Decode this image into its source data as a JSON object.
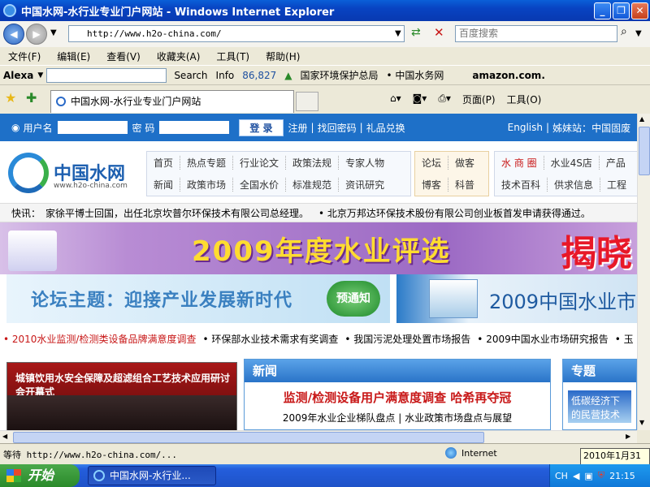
{
  "window": {
    "title": "中国水网-水行业专业门户网站 - Windows Internet Explorer"
  },
  "address": {
    "url": "http://www.h2o-china.com/",
    "search_placeholder": "百度搜索"
  },
  "menu": [
    "文件(F)",
    "编辑(E)",
    "查看(V)",
    "收藏夹(A)",
    "工具(T)",
    "帮助(H)"
  ],
  "alexa": {
    "brand": "Alexa",
    "search_label": "Search",
    "info_label": "Info",
    "rank": "86,827",
    "link1": "国家环境保护总局",
    "link2": "• 中国水务网",
    "amazon": "amazon.com."
  },
  "tab": {
    "title": "中国水网-水行业专业门户网站",
    "page_label": "页面(P)",
    "tools_label": "工具(O)"
  },
  "login": {
    "user_label": "用户名",
    "password_label": "密 码",
    "login_button": "登 录",
    "register": "注册",
    "forgot": "找回密码",
    "gift": "礼品兑换",
    "english": "English",
    "sister_label": "姊妹站：",
    "sister_value": "中国固废"
  },
  "logo": {
    "cn": "中国水网",
    "en": "www.h2o-china.com"
  },
  "nav": {
    "box1_row1": [
      "首页",
      "热点专题",
      "行业论文",
      "政策法规",
      "专家人物"
    ],
    "box1_row2": [
      "新闻",
      "政策市场",
      "全国水价",
      "标准规范",
      "资讯研究"
    ],
    "box2_row1": [
      "论坛",
      "做客"
    ],
    "box2_row2": [
      "博客",
      "科普"
    ],
    "box3_row1": [
      "水 商 圈",
      "水业4S店",
      "产品"
    ],
    "box3_row2": [
      "技术百科",
      "供求信息",
      "工程"
    ]
  },
  "ticker": {
    "label": "快讯：",
    "item1": "家徐平博士回国，出任北京坎普尔环保技术有限公司总经理。",
    "item2": "• 北京万邦达环保技术股份有限公司创业板首发申请获得通过。"
  },
  "banner1": {
    "text": "2009年度水业评选",
    "highlight": "揭晓"
  },
  "banner2": {
    "text": "论坛主题：迎接产业发展新时代",
    "badge": "预通知"
  },
  "banner3": {
    "text": "2009中国水业市"
  },
  "links": [
    {
      "text": "• 2010水业监测/检测类设备品牌满意度调查",
      "red": true
    },
    {
      "text": "• 环保部水业技术需求有奖调查",
      "red": false
    },
    {
      "text": "• 我国污泥处理处置市场报告",
      "red": false
    },
    {
      "text": "• 2009中国水业市场研究报告",
      "red": false
    },
    {
      "text": "• 玉",
      "red": false
    }
  ],
  "photo": {
    "caption": "城镇饮用水安全保障及超滤组合工艺技术应用研讨会开幕式"
  },
  "news": {
    "heading": "新闻",
    "headline": "监测/检测设备用户满意度调查  哈希再夺冠",
    "sub1": "2009年水业企业梯队盘点",
    "sub2": "水业政策市场盘点与展望"
  },
  "special": {
    "heading": "专题",
    "img_text": "低碳经济下的民营技术"
  },
  "status": {
    "message": "等待 http://www.h2o-china.com/...",
    "zone": "Internet",
    "date": "2010年1月31日"
  },
  "taskbar": {
    "start": "开始",
    "task": "中国水网-水行业...",
    "lang": "CH",
    "time": "21:15"
  }
}
